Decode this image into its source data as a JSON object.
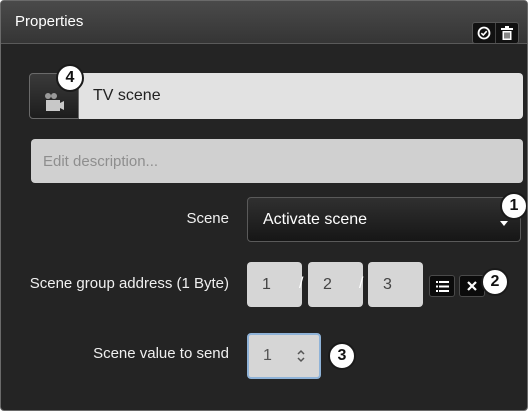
{
  "header": {
    "title": "Properties"
  },
  "header_buttons": {
    "check_icon": "check-circle",
    "delete_icon": "trash"
  },
  "scene": {
    "icon": "clapperboard-scene-icon",
    "name": "TV scene",
    "description_placeholder": "Edit description..."
  },
  "fields": {
    "scene_label": "Scene",
    "scene_value": "Activate scene",
    "group_address_label": "Scene group address (1 Byte)",
    "group_address": [
      "1",
      "2",
      "3"
    ],
    "group_address_separator": "/",
    "scene_value_label": "Scene value to send",
    "scene_value_to_send": "1"
  },
  "callouts": [
    "1",
    "2",
    "3",
    "4"
  ]
}
